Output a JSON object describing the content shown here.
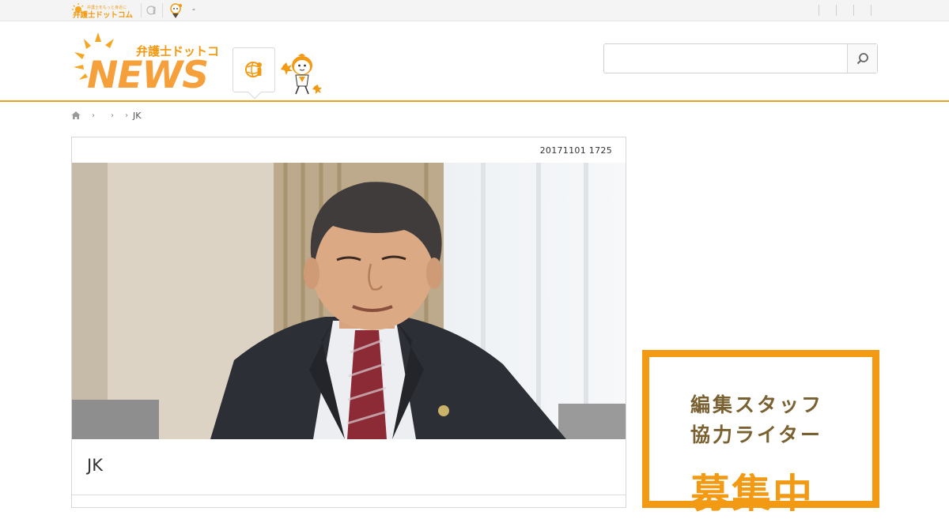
{
  "topbar": {
    "dash": "-",
    "small_logo_tagline": "弁護士をもっと身近に",
    "small_logo_text": "弁護士ドットコム"
  },
  "header": {
    "logo_kana": "弁護士ドットコム",
    "logo_word": "NEWS",
    "search": {
      "value": "",
      "placeholder": ""
    }
  },
  "breadcrumb": {
    "items": [
      "",
      "",
      "JK"
    ]
  },
  "article": {
    "date": "20171101 1725",
    "title": "JK"
  },
  "banner": {
    "line1": "編集スタッフ",
    "line2": "協力ライター",
    "line3": "募集中"
  },
  "colors": {
    "accent": "#f29a13",
    "header_rule": "#e6a526",
    "banner_text": "#7a6132"
  }
}
